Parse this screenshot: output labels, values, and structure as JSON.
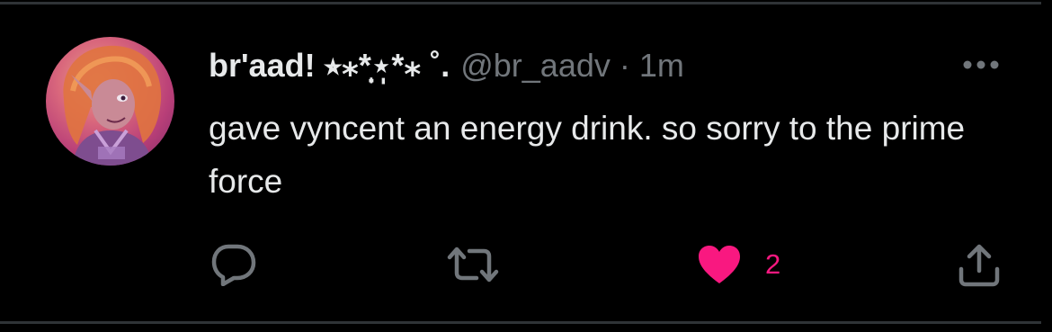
{
  "tweet": {
    "author": {
      "display_name": "br'aad! ⭒⁎*̣̩⋆̩*⁎ ˚.",
      "handle": "@br_aadv"
    },
    "separator": "·",
    "time": "1m",
    "text": "gave vyncent an energy drink. so sorry to the prime force",
    "actions": {
      "reply_icon": "reply-icon",
      "retweet_icon": "retweet-icon",
      "like_icon": "heart-icon",
      "like_count": "2",
      "share_icon": "share-icon"
    },
    "more_icon": "more-icon"
  },
  "colors": {
    "background": "#000000",
    "text_primary": "#e7e9ea",
    "text_secondary": "#71767b",
    "like_active": "#f91880",
    "border": "#2f3336"
  }
}
